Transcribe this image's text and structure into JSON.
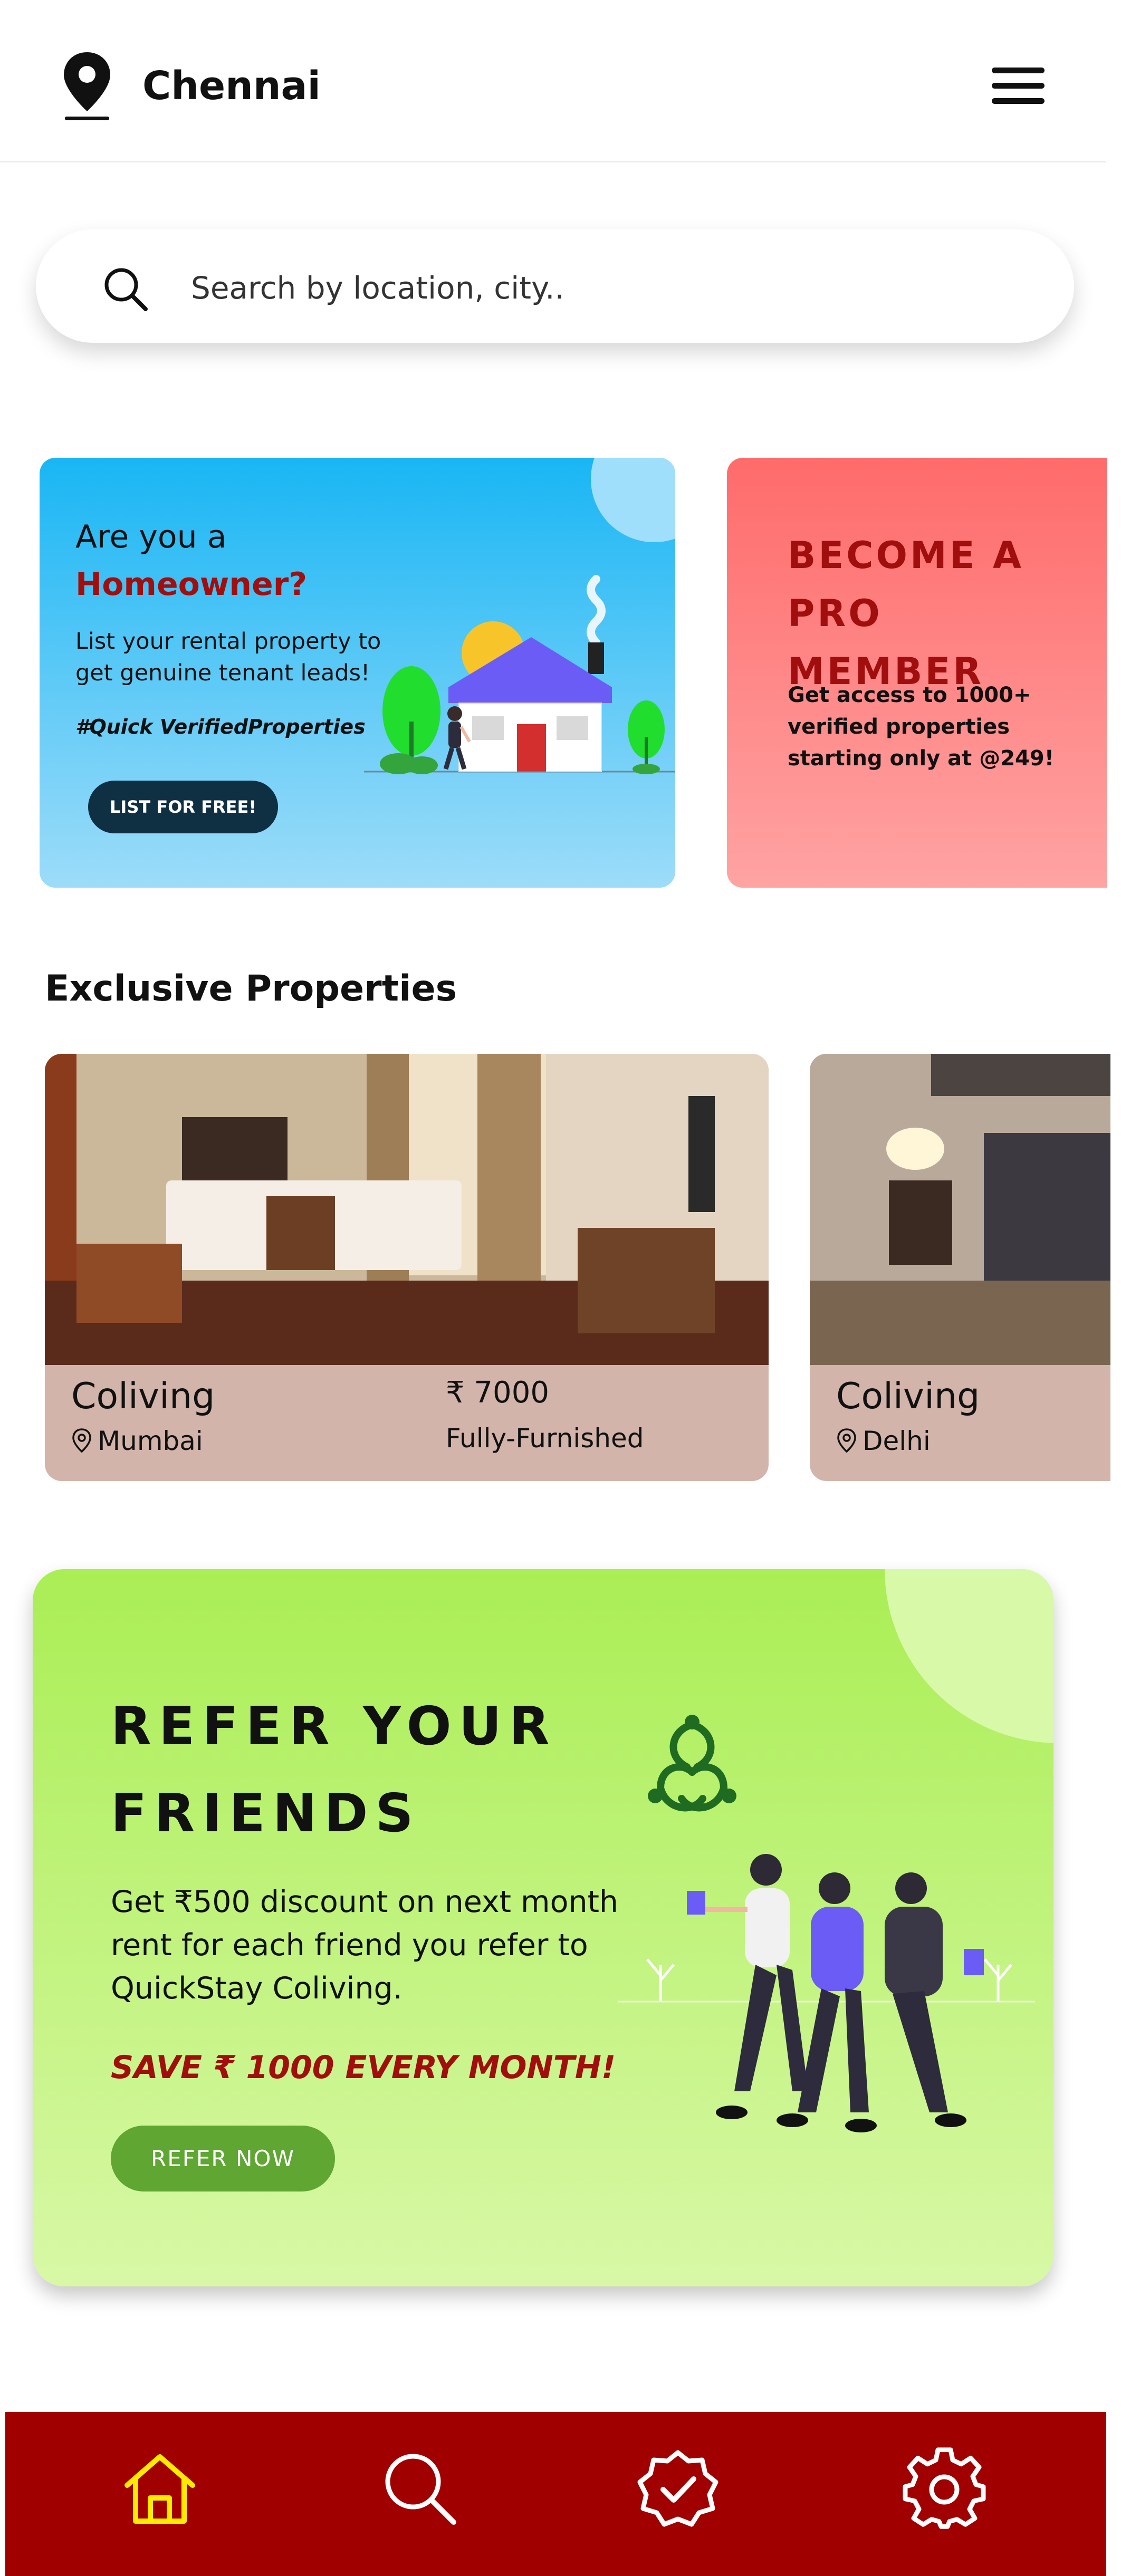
{
  "header": {
    "city": "Chennai"
  },
  "search": {
    "placeholder": "Search by location, city.."
  },
  "banners": {
    "homeowner": {
      "title_line1": "Are you a",
      "title_line2": "Homeowner?",
      "description": "List your rental property to get genuine tenant leads!",
      "tag": "#Quick VerifiedProperties",
      "button_label": "LIST FOR FREE!"
    },
    "pro_member": {
      "title": "BECOME A PRO MEMBER",
      "description": "Get access to 1000+ verified properties starting only at @249!"
    }
  },
  "exclusive": {
    "title": "Exclusive Properties",
    "properties": [
      {
        "type": "Coliving",
        "location": "Mumbai",
        "price": "₹ 7000",
        "furnishing": "Fully-Furnished"
      },
      {
        "type": "Coliving",
        "location": "Delhi"
      }
    ]
  },
  "refer": {
    "title": "REFER YOUR FRIENDS",
    "description": "Get ₹500 discount on next month rent for each friend you refer to QuickStay Coliving.",
    "save_text": "SAVE ₹ 1000 EVERY MONTH!",
    "button_label": "REFER NOW"
  },
  "bottom_nav": {
    "items": [
      "home-icon",
      "search-icon",
      "verified-icon",
      "settings-icon"
    ],
    "active": "home-icon",
    "active_color": "#ffea00",
    "background": "#a00000"
  },
  "colors": {
    "accent_red": "#a10e0e",
    "refer_green": "#5fa632",
    "card_bg": "#d2b4aa"
  }
}
